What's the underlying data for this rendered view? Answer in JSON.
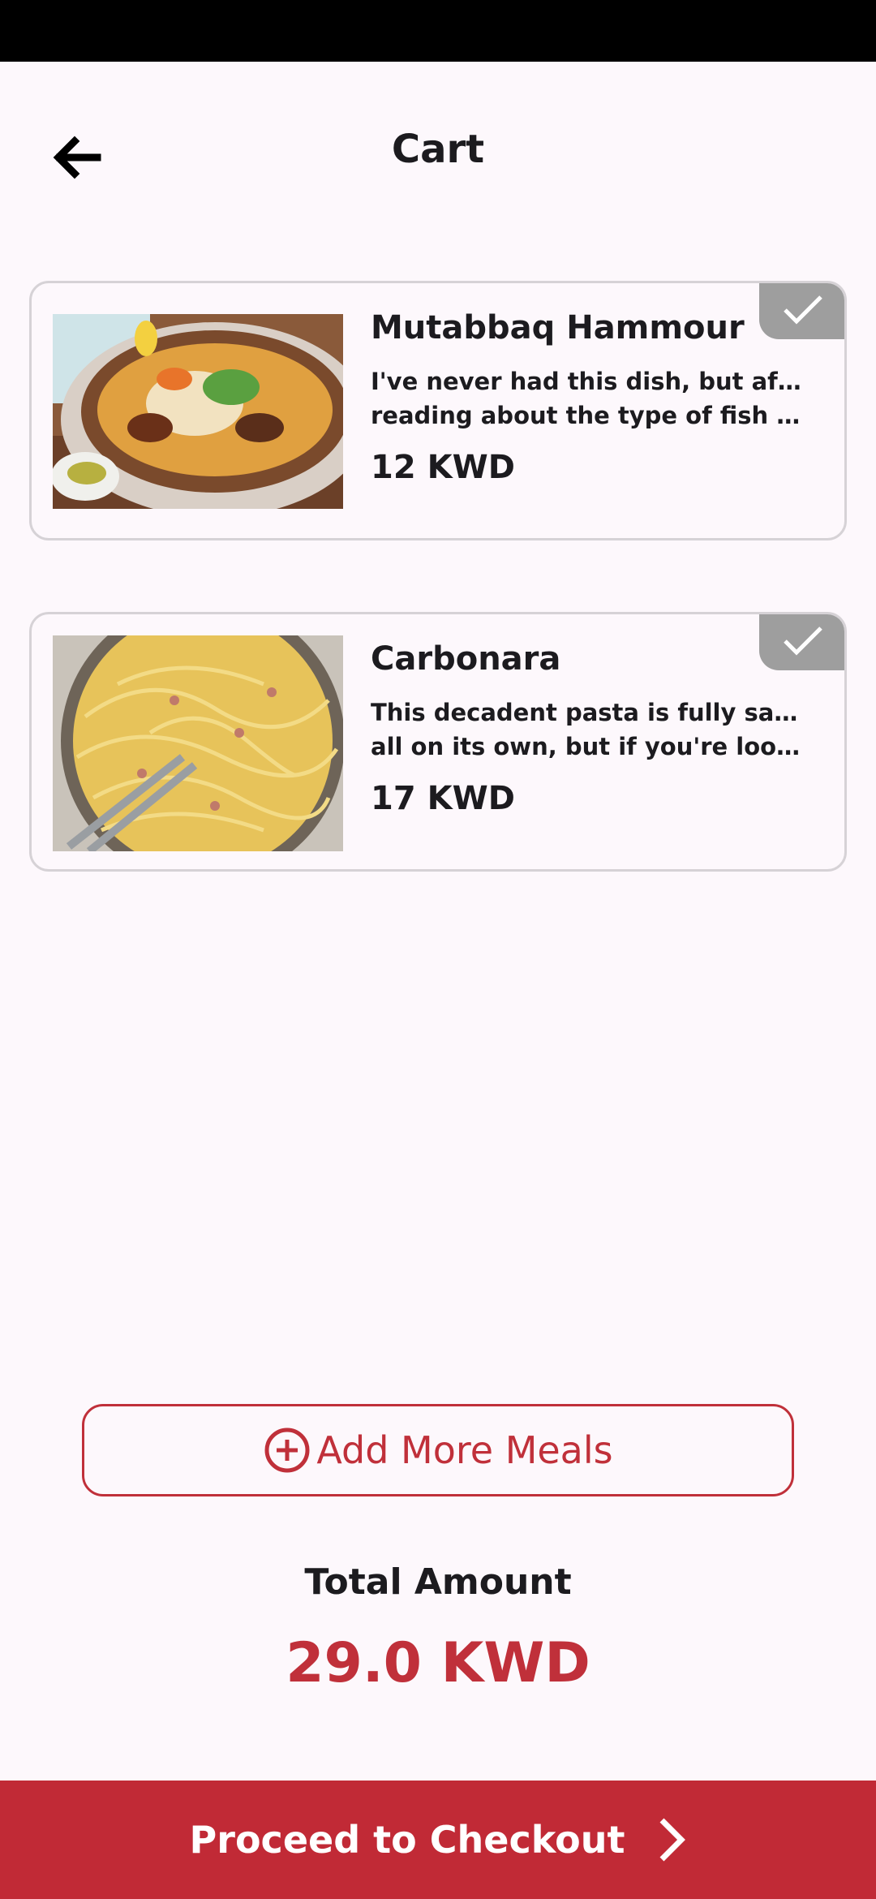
{
  "header": {
    "title": "Cart",
    "back_icon": "arrow-left-icon"
  },
  "cart": {
    "items": [
      {
        "name": "Mutabbaq Hammour",
        "description_line1": "I've never had this dish, but after",
        "description_line2": "reading about the type of fish typic...",
        "price": "12 KWD",
        "selected": true,
        "image": "mutabbaq-hammour-dish-photo"
      },
      {
        "name": "Carbonara",
        "description_line1": "This decadent pasta is fully satisfying",
        "description_line2": "all on its own, but if you're looking ...",
        "price": "17 KWD",
        "selected": true,
        "image": "carbonara-pasta-photo"
      }
    ]
  },
  "actions": {
    "add_more_label": "Add More Meals",
    "add_icon": "plus-circle-icon",
    "checkout_label": "Proceed to Checkout",
    "checkout_icon": "chevron-right-icon"
  },
  "summary": {
    "total_label": "Total Amount",
    "total_value": "29.0 KWD"
  },
  "colors": {
    "accent": "#c0303a",
    "checkout_bar": "#c12a36",
    "background": "#fdf8fc",
    "badge": "#9e9e9e"
  }
}
